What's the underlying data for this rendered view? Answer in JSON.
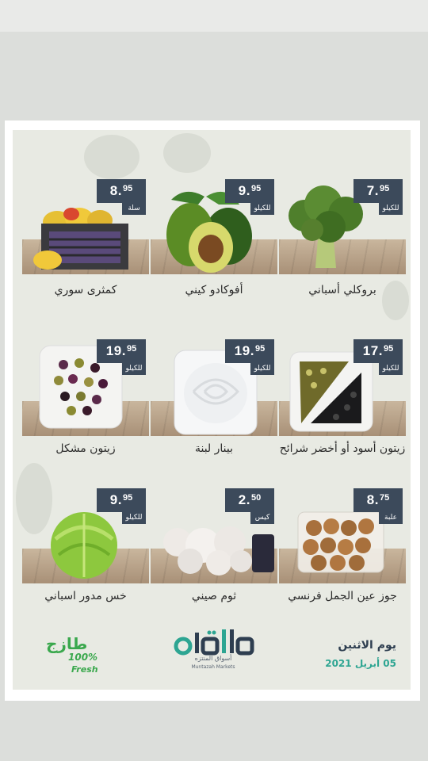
{
  "products": [
    {
      "name": "بروكلي أسباني",
      "price_int": "7",
      "price_dec": "95",
      "unit": "للكيلو",
      "icon": "broccoli-icon"
    },
    {
      "name": "أفوكادو كيني",
      "price_int": "9",
      "price_dec": "95",
      "unit": "للكيلو",
      "icon": "avocado-icon"
    },
    {
      "name": "كمثرى سوري",
      "price_int": "8",
      "price_dec": "95",
      "unit": "سلة",
      "icon": "pear-basket-icon"
    },
    {
      "name": "زيتون أسود أو أخضر شرائح",
      "price_int": "17",
      "price_dec": "95",
      "unit": "للكيلو",
      "icon": "sliced-olives-icon"
    },
    {
      "name": "بينار لبنة",
      "price_int": "19",
      "price_dec": "95",
      "unit": "للكيلو",
      "icon": "labneh-icon"
    },
    {
      "name": "زيتون مشكل",
      "price_int": "19",
      "price_dec": "95",
      "unit": "للكيلو",
      "icon": "mixed-olives-icon"
    },
    {
      "name": "جوز عين الجمل فرنسي",
      "price_int": "8",
      "price_dec": "75",
      "unit": "علبة",
      "icon": "walnuts-icon"
    },
    {
      "name": "ثوم صيني",
      "price_int": "2",
      "price_dec": "50",
      "unit": "كيس",
      "icon": "garlic-icon"
    },
    {
      "name": "خس مدور اسباني",
      "price_int": "9",
      "price_dec": "95",
      "unit": "للكيلو",
      "icon": "lettuce-icon"
    }
  ],
  "footer": {
    "day": "يوم الاثنين",
    "date": "05 أبريل 2021",
    "logo_ar": "أسواق المنتزه",
    "logo_en": "Muntazah Markets",
    "fresh_ar": "طازج",
    "fresh_pct": "100%",
    "fresh_en": "Fresh"
  },
  "colors": {
    "price_bg": "#3c4a5b",
    "brand_teal": "#2da592",
    "fresh_green": "#3aa84d"
  }
}
